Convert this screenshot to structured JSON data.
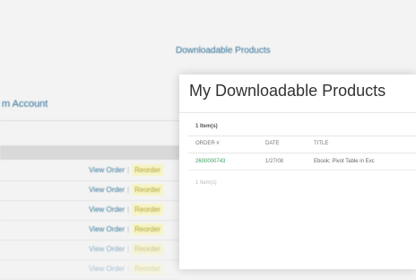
{
  "account": {
    "title": "m Account",
    "orders": [
      {
        "view": "View Order",
        "sep": "|",
        "reorder": "Reorder"
      },
      {
        "view": "View Order",
        "sep": "|",
        "reorder": "Reorder"
      },
      {
        "view": "View Order",
        "sep": "|",
        "reorder": "Reorder"
      },
      {
        "view": "View Order",
        "sep": "|",
        "reorder": "Reorder"
      },
      {
        "view": "View Order",
        "sep": "|",
        "reorder": "Reorder"
      },
      {
        "view": "View Order",
        "sep": "|",
        "reorder": "Reorder"
      }
    ]
  },
  "downloads_link": "Downloadable Products",
  "panel": {
    "title": "My Downloadable Products",
    "items_count": "1 Item(s)",
    "columns": {
      "order": "ORDER #",
      "date": "DATE",
      "title": "TITLE"
    },
    "rows": [
      {
        "order": "2600000743",
        "date": "1/27/08",
        "title": "Ebook: Pivot Table in Exc"
      }
    ],
    "items_count_bottom": "1 Item(s)"
  },
  "colors": {
    "link": "#2f6f98",
    "order_link": "#3aa15a",
    "reorder_bg": "#f6f4c6"
  }
}
